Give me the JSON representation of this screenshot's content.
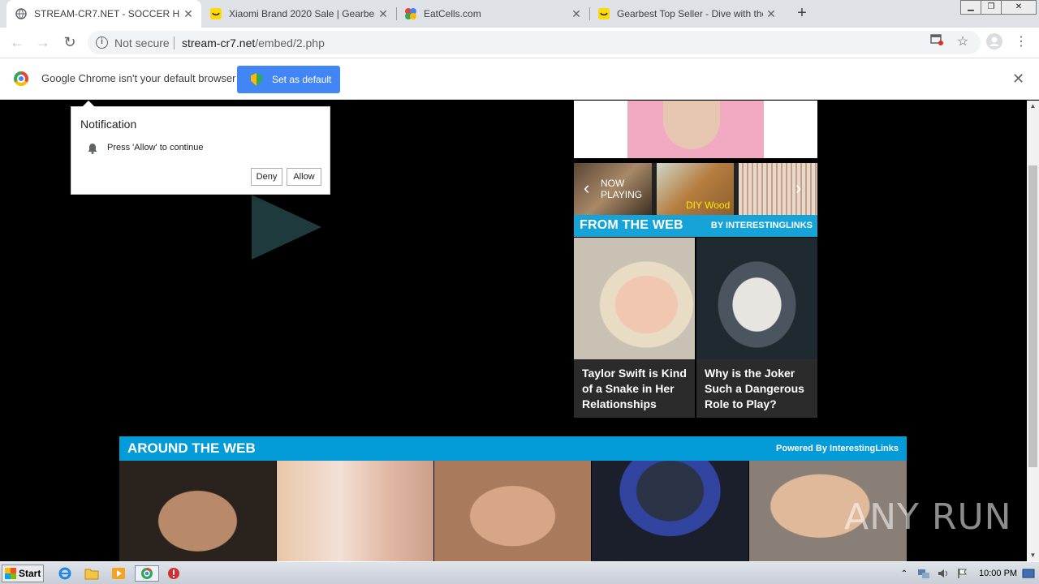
{
  "browser": {
    "tabs": [
      {
        "title": "STREAM-CR7.NET - SOCCER HD Pla",
        "active": true,
        "icon": "globe-icon"
      },
      {
        "title": "Xiaomi Brand 2020 Sale | Gearbest",
        "active": false,
        "icon": "gearbest-icon"
      },
      {
        "title": "EatCells.com",
        "active": false,
        "icon": "eatcells-icon"
      },
      {
        "title": "Gearbest Top Seller - Dive with the C",
        "active": false,
        "icon": "gearbest-icon"
      }
    ],
    "new_tab": "+",
    "window_controls": {
      "minimize": "▁",
      "restore": "❐",
      "close": "✕"
    },
    "address": {
      "security_label": "Not secure",
      "url_host": "stream-cr7.net",
      "url_path": "/embed/2.php"
    }
  },
  "infobar": {
    "message": "Google Chrome isn't your default browser",
    "button": "Set as default",
    "close": "✕"
  },
  "notification": {
    "title": "Notification",
    "body": "Press 'Allow' to continue",
    "deny": "Deny",
    "allow": "Allow"
  },
  "carousel": {
    "now_playing": "NOW PLAYING",
    "diy_label": "DIY Wood"
  },
  "from_the_web": {
    "heading": "FROM THE WEB",
    "by": "BY INTERESTINGLINKS",
    "cards": [
      {
        "caption": "Taylor Swift is Kind of a Snake in Her Relationships"
      },
      {
        "caption": "Why is the Joker Such a Dangerous Role to Play?"
      }
    ]
  },
  "around_the_web": {
    "heading": "AROUND THE WEB",
    "powered": "Powered By InterestingLinks"
  },
  "watermark": "ANY RUN",
  "taskbar": {
    "start": "Start",
    "clock": "10:00 PM"
  }
}
